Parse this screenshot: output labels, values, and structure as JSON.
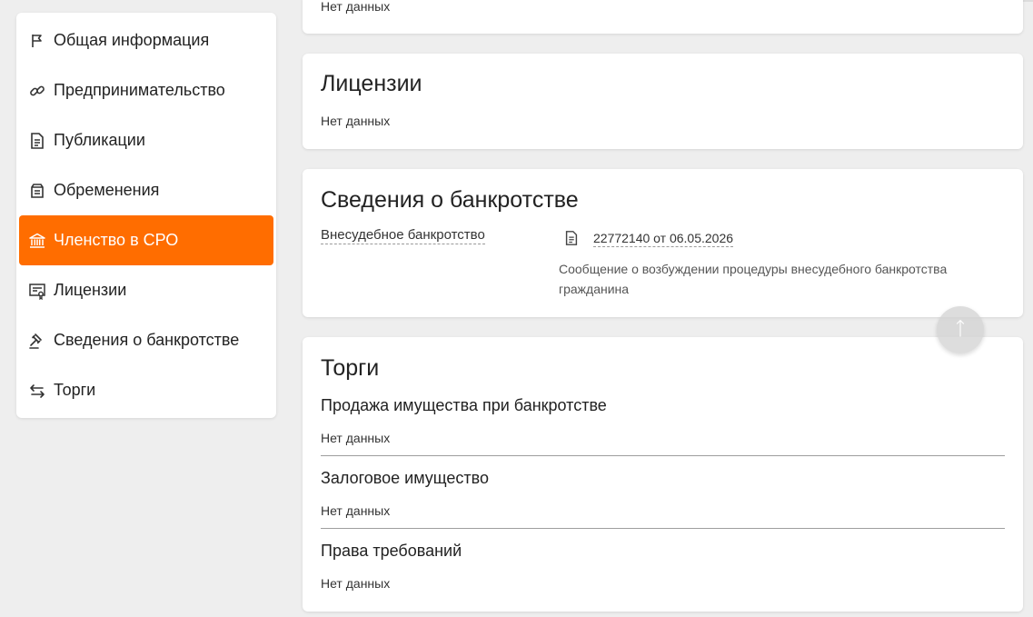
{
  "sidebar": {
    "items": [
      {
        "label": "Общая информация",
        "icon": "flag-icon"
      },
      {
        "label": "Предпринимательство",
        "icon": "link-icon"
      },
      {
        "label": "Публикации",
        "icon": "document-icon"
      },
      {
        "label": "Обременения",
        "icon": "archive-icon"
      },
      {
        "label": "Членство в СРО",
        "icon": "bank-icon",
        "active": true
      },
      {
        "label": "Лицензии",
        "icon": "certificate-icon"
      },
      {
        "label": "Сведения о банкротстве",
        "icon": "gavel-icon"
      },
      {
        "label": "Торги",
        "icon": "swap-icon"
      }
    ]
  },
  "top_card": {
    "empty": "Нет данных"
  },
  "licenses": {
    "title": "Лицензии",
    "empty": "Нет данных"
  },
  "bankruptcy": {
    "title": "Сведения о банкротстве",
    "type_link": "Внесудебное банкротство",
    "message_link": "22772140 от 06.05.2026",
    "message_line1": "Сообщение о возбуждении процедуры внесудебного банкротства",
    "message_line2": "гражданина"
  },
  "auctions": {
    "title": "Торги",
    "sections": [
      {
        "title": "Продажа имущества при банкротстве",
        "empty": "Нет данных"
      },
      {
        "title": "Залоговое имущество",
        "empty": "Нет данных"
      },
      {
        "title": "Права требований",
        "empty": "Нет данных"
      }
    ]
  },
  "colors": {
    "accent": "#ff6d00",
    "background": "#eeeeee",
    "card": "#ffffff"
  }
}
